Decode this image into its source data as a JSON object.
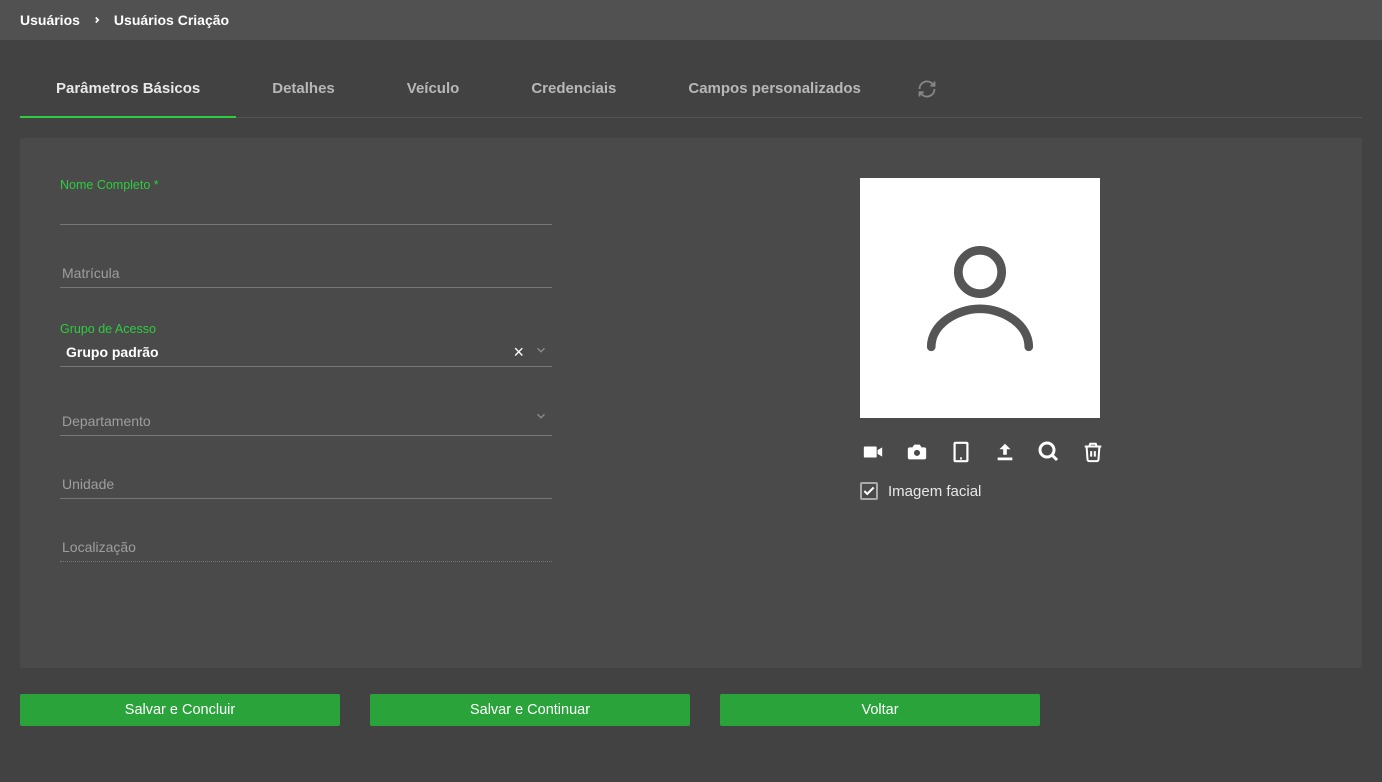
{
  "breadcrumb": {
    "root": "Usuários",
    "current": "Usuários Criação"
  },
  "tabs": {
    "items": [
      {
        "label": "Parâmetros Básicos",
        "active": true
      },
      {
        "label": "Detalhes",
        "active": false
      },
      {
        "label": "Veículo",
        "active": false
      },
      {
        "label": "Credenciais",
        "active": false
      },
      {
        "label": "Campos personalizados",
        "active": false
      }
    ]
  },
  "form": {
    "name_label": "Nome Completo *",
    "name_value": "",
    "matricula_placeholder": "Matrícula",
    "matricula_value": "",
    "grupo_label": "Grupo de Acesso",
    "grupo_value": "Grupo padrão",
    "departamento_placeholder": "Departamento",
    "departamento_value": "",
    "unidade_placeholder": "Unidade",
    "unidade_value": "",
    "localizacao_placeholder": "Localização",
    "localizacao_value": ""
  },
  "photo": {
    "facial_label": "Imagem facial",
    "facial_checked": true,
    "icons": {
      "video": "video-icon",
      "camera": "camera-icon",
      "device": "tablet-icon",
      "upload": "upload-icon",
      "zoom": "search-icon",
      "delete": "trash-icon"
    }
  },
  "buttons": {
    "save_close": "Salvar e Concluir",
    "save_continue": "Salvar e Continuar",
    "back": "Voltar"
  }
}
